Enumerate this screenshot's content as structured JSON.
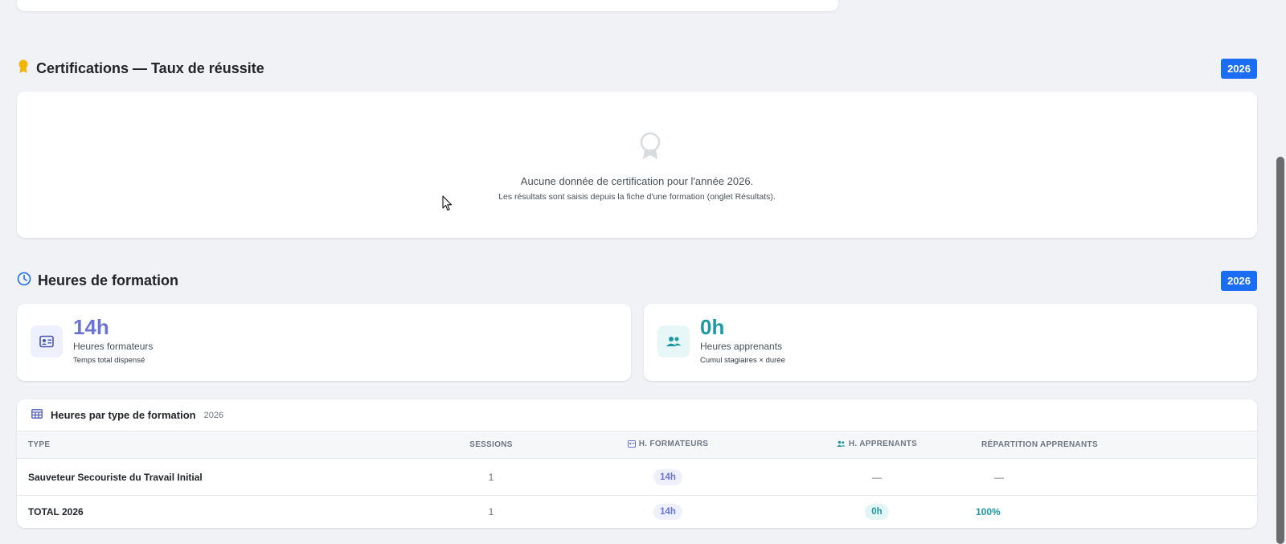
{
  "certifications": {
    "title": "Certifications — Taux de réussite",
    "year": "2026",
    "empty_message": "Aucune donnée de certification pour l'année 2026.",
    "empty_hint": "Les résultats sont saisis depuis la fiche d'une formation (onglet Résultats)."
  },
  "hours": {
    "title": "Heures de formation",
    "year": "2026",
    "trainers": {
      "value": "14h",
      "label": "Heures formateurs",
      "sub": "Temps total dispensé"
    },
    "learners": {
      "value": "0h",
      "label": "Heures apprenants",
      "sub": "Cumul stagiaires × durée"
    }
  },
  "table": {
    "title": "Heures par type de formation",
    "year": "2026",
    "columns": {
      "type": "TYPE",
      "sessions": "SESSIONS",
      "trainer_hours": "H. FORMATEURS",
      "learner_hours": "H. APPRENANTS",
      "distribution": "RÉPARTITION APPRENANTS"
    },
    "rows": [
      {
        "type": "Sauveteur Secouriste du Travail Initial",
        "sessions": "1",
        "trainer_hours": "14h",
        "learner_hours": "—",
        "distribution": "—"
      }
    ],
    "total": {
      "type": "TOTAL 2026",
      "sessions": "1",
      "trainer_hours": "14h",
      "learner_hours": "0h",
      "distribution": "100%"
    }
  },
  "colors": {
    "badge": "#1b6ef3",
    "trainer_accent": "#6b74d6",
    "learner_accent": "#1d9aa2",
    "certification_icon": "#f5b400"
  },
  "icons": {
    "certifications": "award-icon",
    "hours": "clock-icon",
    "trainers": "id-card-icon",
    "learners": "users-icon",
    "table": "table-icon"
  }
}
